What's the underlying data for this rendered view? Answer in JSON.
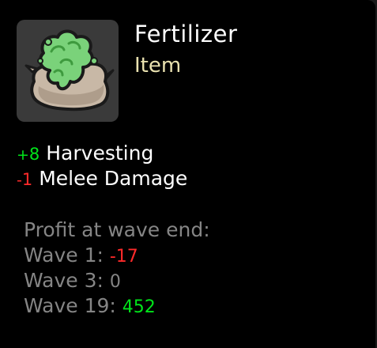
{
  "item": {
    "name": "Fertilizer",
    "type": "Item",
    "icon": "fertilizer-sack-icon"
  },
  "stats": [
    {
      "sign": "+",
      "value": "8",
      "label": "Harvesting",
      "color": "#00e51a"
    },
    {
      "sign": "-",
      "value": "1",
      "label": "Melee Damage",
      "color": "#ff2a2a"
    }
  ],
  "profit": {
    "header": "Profit at wave end:",
    "waves": [
      {
        "label": "Wave 1:",
        "value": "-17",
        "color": "#ff2a2a"
      },
      {
        "label": "Wave 3:",
        "value": "0",
        "color": "#858585"
      },
      {
        "label": "Wave 19:",
        "value": "452",
        "color": "#00e51a"
      }
    ]
  },
  "colors": {
    "background": "#000000",
    "icon_frame": "#3a3a3a",
    "type_text": "#eae2b0",
    "positive": "#00e51a",
    "negative": "#ff2a2a",
    "muted": "#858585"
  }
}
